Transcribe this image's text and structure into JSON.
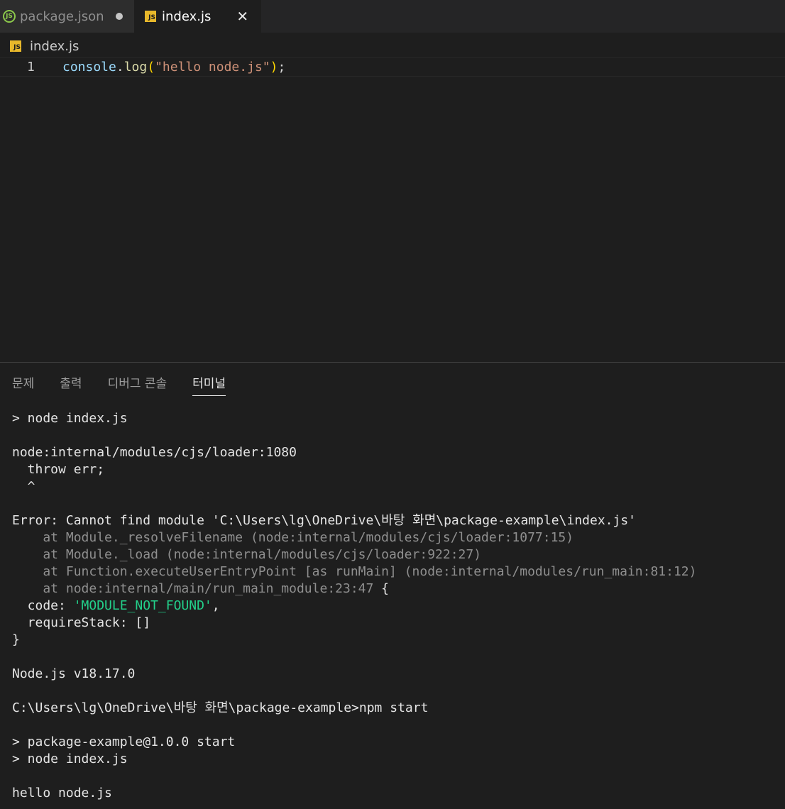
{
  "tabs": [
    {
      "label": "package.json",
      "icon": "nodejs-icon",
      "modified": true,
      "active": false
    },
    {
      "label": "index.js",
      "icon": "js-file-icon",
      "active": true
    }
  ],
  "icons": {
    "js_badge": "JS",
    "node_badge": "JS",
    "close_glyph": "✕"
  },
  "breadcrumb": {
    "file": "index.js"
  },
  "editor": {
    "line_number": "1",
    "code": {
      "obj": "console",
      "dot": ".",
      "method": "log",
      "open": "(",
      "string": "\"hello node.js\"",
      "close": ")",
      "semi": ";"
    }
  },
  "panel": {
    "tabs": [
      "문제",
      "출력",
      "디버그 콘솔",
      "터미널"
    ],
    "active_tab": "터미널"
  },
  "terminal": {
    "l1": "> node index.js",
    "l2": "node:internal/modules/cjs/loader:1080",
    "l3": "  throw err;",
    "l4": "  ^",
    "l5": "Error: Cannot find module 'C:\\Users\\lg\\OneDrive\\바탕 화면\\package-example\\index.js'",
    "l6": "    at Module._resolveFilename (node:internal/modules/cjs/loader:1077:15)",
    "l7": "    at Module._load (node:internal/modules/cjs/loader:922:27)",
    "l8a": "    at Function.executeUserEntryPoint [as runMain] (node:internal/modules/run_main:81:12)",
    "l9a": "    at node:internal/main/run_main_module:23:47",
    "l9b": " {",
    "l10a": "  code: ",
    "l10b": "'MODULE_NOT_FOUND'",
    "l10c": ",",
    "l11": "  requireStack: []",
    "l12": "}",
    "l13": "Node.js v18.17.0",
    "l14": "C:\\Users\\lg\\OneDrive\\바탕 화면\\package-example>npm start",
    "l15": "> package-example@1.0.0 start",
    "l16": "> node index.js",
    "l17": "hello node.js"
  },
  "colors": {
    "background": "#1e1e1e",
    "tab_inactive": "#2d2d2d",
    "string_green": "#23d18b",
    "js_yellow": "#e8b82b",
    "node_green": "#8cc84b"
  }
}
